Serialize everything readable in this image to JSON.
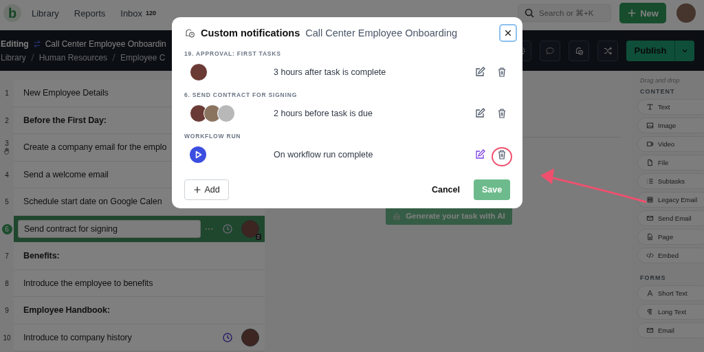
{
  "topbar": {
    "logo": "b",
    "nav": [
      {
        "label": "Library"
      },
      {
        "label": "Reports"
      },
      {
        "label": "Inbox",
        "badge": "120"
      }
    ],
    "search": {
      "placeholder": "Search or ⌘+K"
    },
    "new_button": "New"
  },
  "editor_bar": {
    "mode": "Editing",
    "title": "Call Center Employee Onboardin",
    "breadcrumb": [
      "Library",
      "Human Resources",
      "Employee C"
    ],
    "publish": "Publish"
  },
  "tasks": [
    {
      "number": "1",
      "text": "New Employee Details",
      "kind": "task",
      "selected": false,
      "reminder": false,
      "assignee": false,
      "cursor": false
    },
    {
      "number": "2",
      "text": "Before the First Day:",
      "kind": "heading",
      "selected": false,
      "reminder": false,
      "assignee": false,
      "cursor": false
    },
    {
      "number": "3",
      "text": "Create a company email for the emplo",
      "kind": "task",
      "selected": false,
      "reminder": false,
      "assignee": false,
      "cursor": true
    },
    {
      "number": "4",
      "text": "Send a welcome email",
      "kind": "task",
      "selected": false,
      "reminder": false,
      "assignee": false,
      "cursor": false
    },
    {
      "number": "5",
      "text": "Schedule start date on Google Calen",
      "kind": "task",
      "selected": false,
      "reminder": false,
      "assignee": false,
      "cursor": false
    },
    {
      "number": "6",
      "text": "Send contract for signing",
      "kind": "task",
      "selected": true,
      "reminder": true,
      "assignee": true,
      "assignee_count": "2",
      "cursor": false
    },
    {
      "number": "7",
      "text": "Benefits:",
      "kind": "heading",
      "selected": false,
      "reminder": false,
      "assignee": false,
      "cursor": false
    },
    {
      "number": "8",
      "text": "Introduce the employee to benefits",
      "kind": "task",
      "selected": false,
      "reminder": false,
      "assignee": false,
      "cursor": false
    },
    {
      "number": "9",
      "text": "Employee Handbook:",
      "kind": "heading",
      "selected": false,
      "reminder": false,
      "assignee": false,
      "cursor": false
    },
    {
      "number": "10",
      "text": "Introduce to company history",
      "kind": "task",
      "selected": false,
      "reminder": true,
      "assignee": true,
      "cursor": false
    }
  ],
  "ai_button": "Generate your task with AI",
  "sidebar": {
    "hint": "Drag and drop",
    "sections": [
      {
        "title": "CONTENT",
        "items": [
          {
            "label": "Text",
            "kind": "text"
          },
          {
            "label": "Image",
            "kind": "image"
          },
          {
            "label": "Video",
            "kind": "video"
          },
          {
            "label": "File",
            "kind": "file"
          },
          {
            "label": "Subtasks",
            "kind": "subtasks"
          },
          {
            "label": "Legacy Email",
            "kind": "legacy_email"
          },
          {
            "label": "Send Email",
            "kind": "email"
          },
          {
            "label": "Page",
            "kind": "page"
          },
          {
            "label": "Embed",
            "kind": "embed"
          }
        ]
      },
      {
        "title": "FORMS",
        "items": [
          {
            "label": "Short Text",
            "kind": "short_text"
          },
          {
            "label": "Long Text",
            "kind": "long_text"
          },
          {
            "label": "Email",
            "kind": "email"
          }
        ]
      }
    ]
  },
  "modal": {
    "title": "Custom notifications",
    "subtitle": "Call Center Employee Onboarding",
    "groups": [
      {
        "heading": "19. APPROVAL: FIRST TASKS",
        "rules": [
          {
            "kind": "people",
            "recipients": [
              {
                "kind": "photo"
              }
            ],
            "text": "3 hours after task is complete",
            "hovered": false
          }
        ]
      },
      {
        "heading": "6. SEND CONTRACT FOR SIGNING",
        "rules": [
          {
            "kind": "people",
            "recipients": [
              {
                "kind": "photo"
              },
              {
                "kind": "photo"
              },
              {
                "kind": "photo"
              }
            ],
            "text": "2 hours before task is due",
            "hovered": false
          }
        ]
      },
      {
        "heading": "WORKFLOW RUN",
        "rules": [
          {
            "kind": "workflow",
            "text": "On workflow run complete",
            "hovered": true
          }
        ]
      }
    ],
    "add_button": "Add",
    "cancel_button": "Cancel",
    "save": {
      "label": "Save",
      "disabled": true
    }
  }
}
